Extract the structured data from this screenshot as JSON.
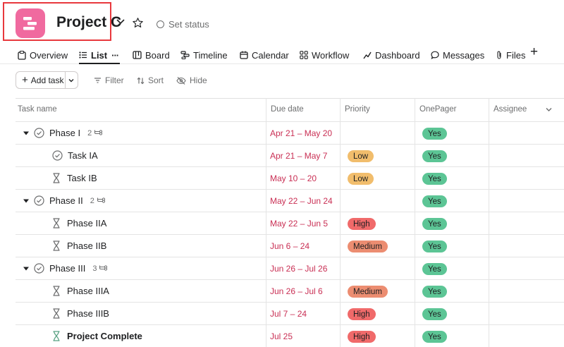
{
  "header": {
    "project_title": "Project C",
    "set_status_label": "Set status",
    "app_icon_color": "#f06a9f"
  },
  "tabs": [
    {
      "label": "Overview",
      "icon": "overview-icon"
    },
    {
      "label": "List",
      "icon": "list-icon",
      "active": true,
      "more": "···"
    },
    {
      "label": "Board",
      "icon": "board-icon"
    },
    {
      "label": "Timeline",
      "icon": "timeline-icon"
    },
    {
      "label": "Calendar",
      "icon": "calendar-icon"
    },
    {
      "label": "Workflow",
      "icon": "workflow-icon"
    },
    {
      "label": "Dashboard",
      "icon": "dashboard-icon"
    },
    {
      "label": "Messages",
      "icon": "messages-icon"
    },
    {
      "label": "Files",
      "icon": "files-icon"
    }
  ],
  "add_tab_label": "+",
  "toolbar": {
    "add_task_label": "Add task",
    "filter_label": "Filter",
    "sort_label": "Sort",
    "hide_label": "Hide"
  },
  "columns": {
    "task_name": "Task name",
    "due_date": "Due date",
    "priority": "Priority",
    "onepager": "OnePager",
    "assignee": "Assignee"
  },
  "colors": {
    "date_red": "#c92f54",
    "low": "#f1bd6c",
    "medium": "#ec8d71",
    "high": "#f06a6a",
    "yes": "#5cc595"
  },
  "rows": [
    {
      "name": "Phase I",
      "type": "section",
      "subtasks": "2",
      "due": "Apr 21 – May 20",
      "priority": "",
      "onepager": "Yes"
    },
    {
      "name": "Task IA",
      "type": "task-check",
      "due": "Apr 21 – May 7",
      "priority": "Low",
      "onepager": "Yes"
    },
    {
      "name": "Task IB",
      "type": "task-hourglass",
      "due": "May 10 – 20",
      "priority": "Low",
      "onepager": "Yes"
    },
    {
      "name": "Phase II",
      "type": "section",
      "subtasks": "2",
      "due": "May 22 – Jun 24",
      "priority": "",
      "onepager": "Yes"
    },
    {
      "name": "Phase IIA",
      "type": "task-hourglass",
      "due": "May 22 – Jun 5",
      "priority": "High",
      "onepager": "Yes"
    },
    {
      "name": "Phase IIB",
      "type": "task-hourglass",
      "due": "Jun 6 – 24",
      "priority": "Medium",
      "onepager": "Yes"
    },
    {
      "name": "Phase III",
      "type": "section",
      "subtasks": "3",
      "due": "Jun 26 – Jul 26",
      "priority": "",
      "onepager": "Yes"
    },
    {
      "name": "Phase IIIA",
      "type": "task-hourglass",
      "due": "Jun 26 – Jul 6",
      "priority": "Medium",
      "onepager": "Yes"
    },
    {
      "name": "Phase IIIB",
      "type": "task-hourglass",
      "due": "Jul 7 – 24",
      "priority": "High",
      "onepager": "Yes"
    },
    {
      "name": "Project Complete",
      "type": "milestone",
      "due": "Jul 25",
      "priority": "High",
      "onepager": "Yes"
    }
  ]
}
